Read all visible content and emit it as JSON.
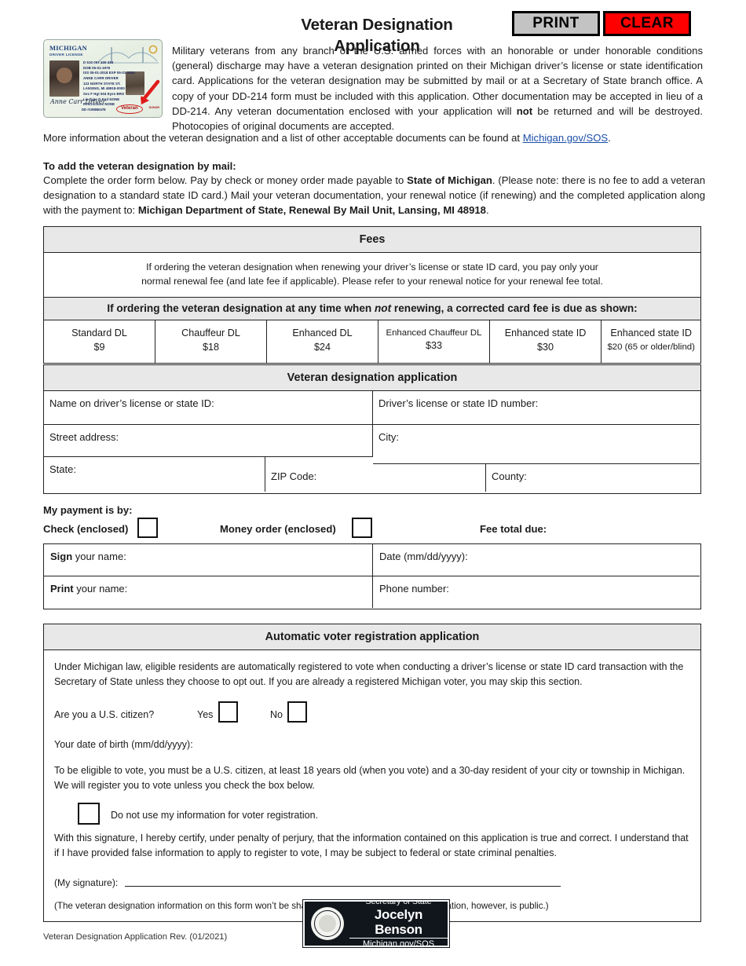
{
  "header": {
    "title": "Veteran Designation Application",
    "print_label": "PRINT",
    "clear_label": "CLEAR"
  },
  "license_card": {
    "state": "MICHIGAN",
    "doc_type": "DRIVER LICENSE",
    "fields_line1": "D 616 067 100 334",
    "fields_line2": "DOB 05-01-1978",
    "fields_line3": "ISS 05-01-2018   EXP 05-01-2022",
    "name": "ANNE CARR DRIVER",
    "address1": "123 NORTH STATE ST.",
    "address2": "LANSING, MI 48918-0000",
    "sex": "Sex F",
    "height": "Hgt 504",
    "eyes": "Eyes BRO",
    "lic_type": "Lic Type D",
    "end": "End NONE",
    "restrictions": "Restrictions NONE",
    "signature": "Anne Carr Driver",
    "doc_disc": "DD #109860478",
    "veteran_stamp": "Veteran",
    "donor": "DONOR"
  },
  "intro": {
    "paragraph_a": "Military veterans from any branch of the U.S. armed forces with an honorable or under honorable conditions (general) discharge may have a veteran designation printed on their Michigan driver’s license or state identification card. Applications for the veteran designation may be submitted by mail or at a Secretary of State branch office. A copy of your DD-214 form must be included with this application. Other documentation may be accepted in lieu of a DD-214. Any veteran documentation enclosed with your application will ",
    "paragraph_a_bold": "not",
    "paragraph_a_end": " be returned and will be destroyed. Photocopies of original documents are accepted.",
    "more_info_before": "More information about the veteran designation and a list of other acceptable documents can be found at ",
    "more_info_link": "Michigan.gov/SOS",
    "more_info_after": "."
  },
  "mail": {
    "heading": "To add the veteran designation by mail:",
    "body_1": "Complete the order form below. Pay by check or money order made payable to ",
    "body_bold_1": "State of Michigan",
    "body_2": ". (Please note: there is no fee to add a veteran designation to a standard state ID card.) Mail your veteran documentation, your renewal notice (if renewing) and the completed application along with the payment to: ",
    "body_bold_2": "Michigan Department of State, Renewal By Mail Unit, Lansing, MI 48918",
    "body_3": "."
  },
  "fees": {
    "title": "Fees",
    "note_line1": "If ordering the veteran designation when renewing your driver’s license or state ID card, you pay only your",
    "note_line2": "normal renewal fee (and late fee if applicable). Please refer to your renewal notice for your renewal fee total.",
    "subheader_before": "If ordering the veteran designation at any time when ",
    "subheader_italic": "not",
    "subheader_after": " renewing, a corrected card fee is due as shown:",
    "columns": [
      {
        "label": "Standard DL",
        "amount": "$9"
      },
      {
        "label": "Chauffeur DL",
        "amount": "$18"
      },
      {
        "label": "Enhanced DL",
        "amount": "$24"
      },
      {
        "label": "Enhanced Chauffeur DL",
        "amount": "$33"
      },
      {
        "label": "Enhanced state ID",
        "amount": "$30"
      },
      {
        "label": "Enhanced state ID",
        "amount": "$20 (65 or older/blind)"
      }
    ]
  },
  "application": {
    "title": "Veteran designation application",
    "name_label": "Name on driver’s license or state ID:",
    "dl_number_label": "Driver’s license or state ID number:",
    "street_label": "Street address:",
    "city_label": "City:",
    "state_label": "State:",
    "zip_label": "ZIP Code:",
    "county_label": "County:",
    "name_value": "",
    "dl_number_value": "",
    "street_value": "",
    "city_value": "",
    "state_value": "",
    "zip_value": "",
    "county_value": ""
  },
  "payment": {
    "heading": "My payment is by:",
    "check_label": "Check (enclosed)",
    "money_order_label": "Money order (enclosed)",
    "fee_total_label": "Fee total due:",
    "fee_total_value": ""
  },
  "signature": {
    "sign_bold": "Sign",
    "sign_rest": " your name:",
    "date_label": "Date (mm/dd/yyyy):",
    "print_bold": "Print",
    "print_rest": " your name:",
    "phone_label": "Phone number:",
    "sign_value": "",
    "date_value": "",
    "print_value": "",
    "phone_value": ""
  },
  "voter": {
    "title": "Automatic voter registration application",
    "intro": "Under Michigan law, eligible residents are automatically registered to vote when conducting a driver’s license or state ID card transaction with the Secretary of State unless they choose to opt out. If you are already a registered Michigan voter, you may skip this section.",
    "citizen_question": "Are you a U.S. citizen?",
    "yes_label": "Yes",
    "no_label": "No",
    "dob_label": "Your date of birth (mm/dd/yyyy):",
    "dob_value": "",
    "eligibility": "To be eligible to vote, you must be a U.S. citizen, at least 18 years old (when you vote) and a 30-day resident of your city or township in Michigan. We will register you to vote unless you check the box below.",
    "optout_label": "Do not use my information for voter registration.",
    "certify": "With this signature, I hereby certify, under penalty of perjury, that the information contained on this application is true and correct. I understand that if I have provided false information to apply to register to vote, I may be subject to federal or state criminal penalties.",
    "signature_label": "(My signature):",
    "signature_value": "",
    "fineprint": "(The veteran designation information on this form won’t be shared. Some voter registration information, however, is public.)"
  },
  "footer": {
    "revision": "Veteran Designation Application Rev. (01/2021)",
    "sos_line1": "Secretary of State",
    "sos_line2": "Jocelyn Benson",
    "sos_line3": "Michigan.gov/SOS"
  },
  "colors": {
    "clear_button": "#ff0000",
    "print_button": "#c3c3c3",
    "header_fill": "#e8e8e8",
    "border": "#222222",
    "link": "#1b4ea8"
  }
}
